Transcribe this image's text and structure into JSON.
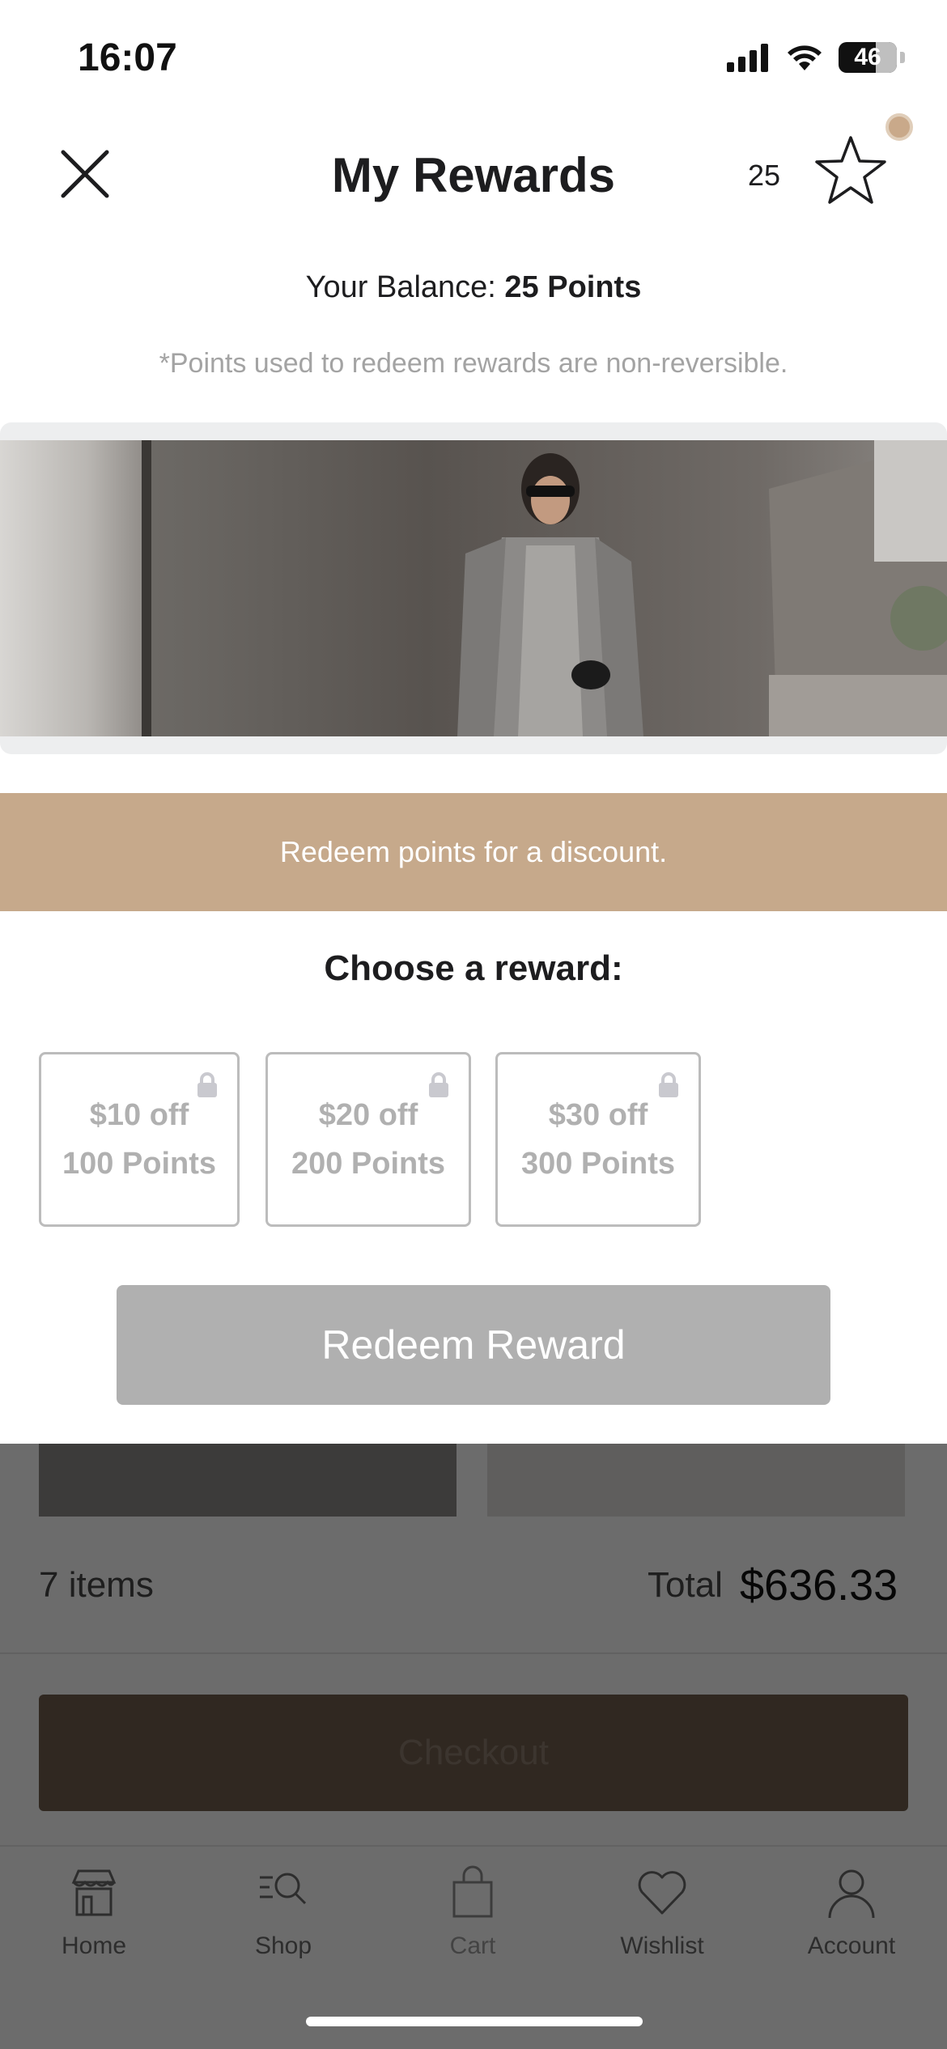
{
  "status_bar": {
    "time": "16:07",
    "battery": "46"
  },
  "header": {
    "title": "My Rewards",
    "points_count": "25"
  },
  "balance": {
    "label": "Your Balance:",
    "value": "25 Points"
  },
  "disclaimer": "*Points used to redeem rewards are non-reversible.",
  "redeem_strip": "Redeem points for a discount.",
  "choose_title": "Choose a reward:",
  "rewards": [
    {
      "amount": "$10 off",
      "points": "100 Points",
      "locked": true
    },
    {
      "amount": "$20 off",
      "points": "200 Points",
      "locked": true
    },
    {
      "amount": "$30 off",
      "points": "300 Points",
      "locked": true
    }
  ],
  "redeem_button": "Redeem Reward",
  "cart": {
    "items": "7 items",
    "total_label": "Total",
    "total_value": "$636.33",
    "checkout": "Checkout"
  },
  "tabs": [
    {
      "label": "Home",
      "icon": "store-icon"
    },
    {
      "label": "Shop",
      "icon": "search-list-icon"
    },
    {
      "label": "Cart",
      "icon": "bag-icon"
    },
    {
      "label": "Wishlist",
      "icon": "heart-icon"
    },
    {
      "label": "Account",
      "icon": "person-icon"
    }
  ],
  "colors": {
    "accent": "#c6a98b",
    "disabled": "#b0b0b0",
    "checkout": "#6d5b4c"
  }
}
